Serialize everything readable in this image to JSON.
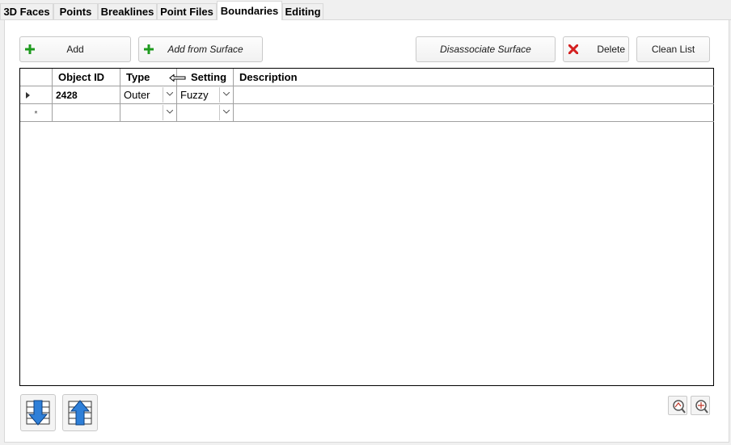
{
  "tabs": [
    {
      "label": "3D Faces"
    },
    {
      "label": "Points"
    },
    {
      "label": "Breaklines"
    },
    {
      "label": "Point Files"
    },
    {
      "label": "Boundaries"
    },
    {
      "label": "Editing"
    }
  ],
  "active_tab": "Boundaries",
  "toolbar": {
    "add_label": "Add",
    "add_from_surface_label": "Add from Surface",
    "disassociate_label": "Disassociate Surface",
    "delete_label": "Delete",
    "clean_list_label": "Clean List"
  },
  "grid": {
    "columns": [
      "Object ID",
      "Type",
      "Setting",
      "Description"
    ],
    "rows": [
      {
        "object_id": "2428",
        "type": "Outer",
        "setting": "Fuzzy",
        "description": ""
      }
    ],
    "new_row_marker": "*"
  },
  "icons": {
    "add": "plus-icon",
    "delete": "x-icon",
    "move_down": "arrow-down-icon",
    "move_up": "arrow-up-icon",
    "zoom": "zoom-icon",
    "zoom_extents": "zoom-extents-icon"
  },
  "colors": {
    "plus_green": "#1e9a1e",
    "delete_red": "#d42020",
    "arrow_blue": "#2e7fd8"
  }
}
